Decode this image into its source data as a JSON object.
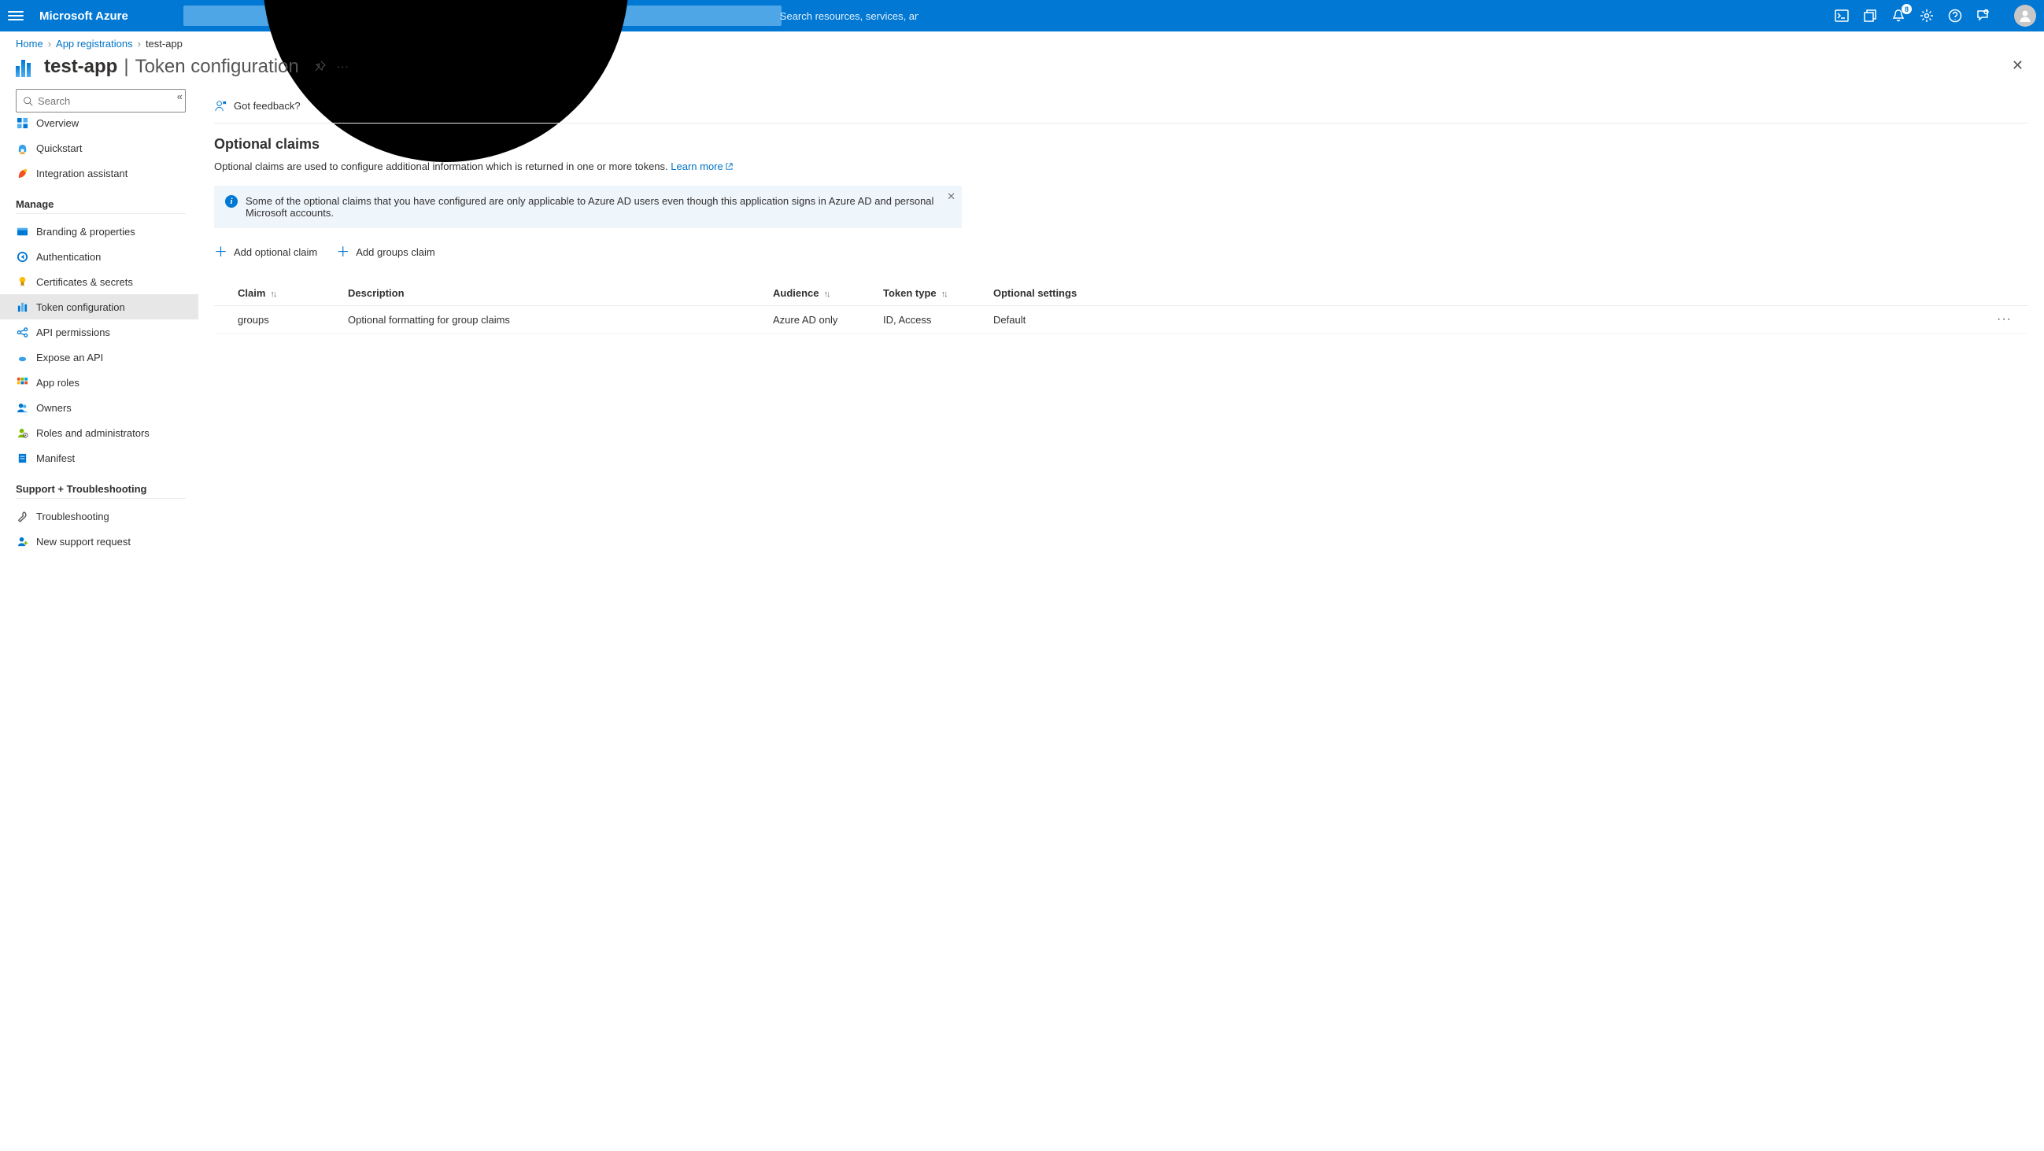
{
  "colors": {
    "brand": "#0078d4",
    "link": "#0072c6"
  },
  "header": {
    "brand": "Microsoft Azure",
    "searchPlaceholder": "Search resources, services, and docs (G+/)",
    "notificationCount": "8"
  },
  "breadcrumb": {
    "home": "Home",
    "level1": "App registrations",
    "current": "test-app"
  },
  "title": {
    "app": "test-app",
    "page": "Token configuration"
  },
  "sidebar": {
    "searchPlaceholder": "Search",
    "top": [
      {
        "label": "Overview"
      },
      {
        "label": "Quickstart"
      },
      {
        "label": "Integration assistant"
      }
    ],
    "manageHeader": "Manage",
    "manage": [
      {
        "label": "Branding & properties"
      },
      {
        "label": "Authentication"
      },
      {
        "label": "Certificates & secrets"
      },
      {
        "label": "Token configuration"
      },
      {
        "label": "API permissions"
      },
      {
        "label": "Expose an API"
      },
      {
        "label": "App roles"
      },
      {
        "label": "Owners"
      },
      {
        "label": "Roles and administrators"
      },
      {
        "label": "Manifest"
      }
    ],
    "supportHeader": "Support + Troubleshooting",
    "support": [
      {
        "label": "Troubleshooting"
      },
      {
        "label": "New support request"
      }
    ]
  },
  "main": {
    "feedback": "Got feedback?",
    "sectionHeading": "Optional claims",
    "sectionDesc": "Optional claims are used to configure additional information which is returned in one or more tokens. ",
    "learnMore": "Learn more",
    "infoBanner": "Some of the optional claims that you have configured are only applicable to Azure AD users even though this application signs in Azure AD and personal Microsoft accounts.",
    "addOptional": "Add optional claim",
    "addGroups": "Add groups claim",
    "columns": {
      "claim": "Claim",
      "description": "Description",
      "audience": "Audience",
      "tokenType": "Token type",
      "optionalSettings": "Optional settings"
    },
    "rows": [
      {
        "claim": "groups",
        "description": "Optional formatting for group claims",
        "audience": "Azure AD only",
        "tokenType": "ID, Access",
        "optionalSettings": "Default"
      }
    ]
  }
}
